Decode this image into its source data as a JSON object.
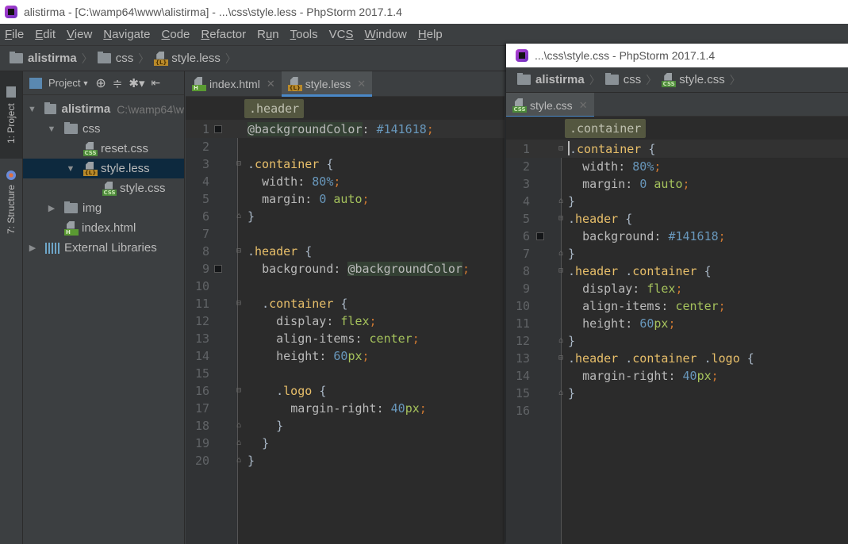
{
  "main_window": {
    "title": "alistirma - [C:\\wamp64\\www\\alistirma] - ...\\css\\style.less - PhpStorm 2017.1.4",
    "menu": [
      {
        "label": "File",
        "mnemonic": "F",
        "rest": "ile"
      },
      {
        "label": "Edit",
        "mnemonic": "E",
        "rest": "dit"
      },
      {
        "label": "View",
        "mnemonic": "V",
        "rest": "iew"
      },
      {
        "label": "Navigate",
        "mnemonic": "N",
        "rest": "avigate"
      },
      {
        "label": "Code",
        "mnemonic": "C",
        "rest": "ode"
      },
      {
        "label": "Refactor",
        "mnemonic": "R",
        "rest": "efactor"
      },
      {
        "label": "Run",
        "pre": "R",
        "mnemonic": "u",
        "rest": "n"
      },
      {
        "label": "Tools",
        "mnemonic": "T",
        "rest": "ools"
      },
      {
        "label": "VCS",
        "pre": "VC",
        "mnemonic": "S",
        "rest": ""
      },
      {
        "label": "Window",
        "mnemonic": "W",
        "rest": "indow"
      },
      {
        "label": "Help",
        "mnemonic": "H",
        "rest": "elp"
      }
    ],
    "breadcrumb": [
      "alistirma",
      "css",
      "style.less"
    ],
    "tool_strip": {
      "project": "1: Project",
      "structure": "7: Structure"
    },
    "project_panel": {
      "view_label": "Project",
      "tree": [
        {
          "label": "alistirma",
          "hint": "C:\\wamp64\\w",
          "type": "folder",
          "expanded": true,
          "level": 0
        },
        {
          "label": "css",
          "type": "folder",
          "expanded": true,
          "level": 1
        },
        {
          "label": "reset.css",
          "type": "css",
          "level": 2
        },
        {
          "label": "style.less",
          "type": "less",
          "expanded": true,
          "level": 2,
          "selected": true
        },
        {
          "label": "style.css",
          "type": "css",
          "level": 3
        },
        {
          "label": "img",
          "type": "folder",
          "expanded": false,
          "level": 1
        },
        {
          "label": "index.html",
          "type": "html",
          "level": 1
        },
        {
          "label": "External Libraries",
          "type": "libs",
          "expanded": false,
          "level": 0
        }
      ]
    },
    "tabs": [
      {
        "label": "index.html",
        "type": "html",
        "active": false
      },
      {
        "label": "style.less",
        "type": "less",
        "active": true
      }
    ],
    "code_crumb": ".header",
    "lines": [
      "@backgroundColor: #141618;",
      "",
      ".container {",
      "  width: 80%;",
      "  margin: 0 auto;",
      "}",
      "",
      ".header {",
      "  background: @backgroundColor;",
      "",
      "  .container {",
      "    display: flex;",
      "    align-items: center;",
      "    height: 60px;",
      "",
      "    .logo {",
      "      margin-right: 40px;",
      "    }",
      "  }",
      "}"
    ]
  },
  "second_window": {
    "title": "...\\css\\style.css - PhpStorm 2017.1.4",
    "breadcrumb": [
      "alistirma",
      "css",
      "style.css"
    ],
    "tabs": [
      {
        "label": "style.css",
        "type": "css",
        "active": true
      }
    ],
    "code_crumb": ".container",
    "lines": [
      ".container {",
      "  width: 80%;",
      "  margin: 0 auto;",
      "}",
      ".header {",
      "  background: #141618;",
      "}",
      ".header .container {",
      "  display: flex;",
      "  align-items: center;",
      "  height: 60px;",
      "}",
      ".header .container .logo {",
      "  margin-right: 40px;",
      "}",
      ""
    ]
  },
  "colors": {
    "swatch": "#141618",
    "accent": "#4a88c7"
  }
}
